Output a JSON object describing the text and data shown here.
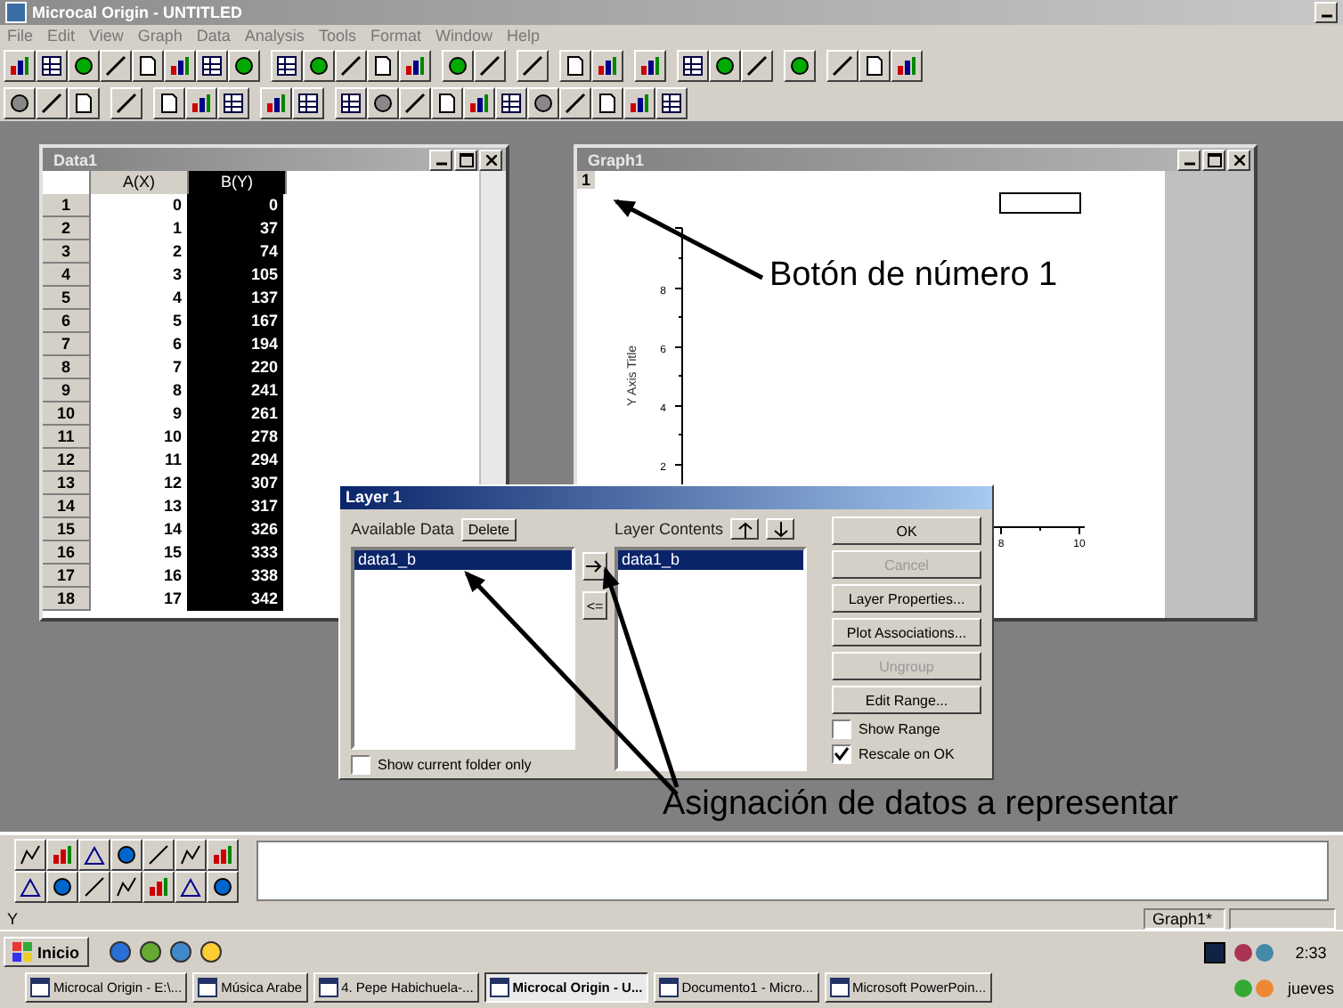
{
  "window": {
    "title": "Microcal Origin - UNTITLED"
  },
  "menu": [
    "File",
    "Edit",
    "View",
    "Graph",
    "Data",
    "Analysis",
    "Tools",
    "Format",
    "Window",
    "Help"
  ],
  "worksheet": {
    "title": "Data1",
    "columns": [
      {
        "label": "A(X)",
        "selected": false
      },
      {
        "label": "B(Y)",
        "selected": true
      }
    ],
    "rows": [
      {
        "index": "1",
        "values": [
          "0",
          "0"
        ]
      },
      {
        "index": "2",
        "values": [
          "1",
          "37"
        ]
      },
      {
        "index": "3",
        "values": [
          "2",
          "74"
        ]
      },
      {
        "index": "4",
        "values": [
          "3",
          "105"
        ]
      },
      {
        "index": "5",
        "values": [
          "4",
          "137"
        ]
      },
      {
        "index": "6",
        "values": [
          "5",
          "167"
        ]
      },
      {
        "index": "7",
        "values": [
          "6",
          "194"
        ]
      },
      {
        "index": "8",
        "values": [
          "7",
          "220"
        ]
      },
      {
        "index": "9",
        "values": [
          "8",
          "241"
        ]
      },
      {
        "index": "10",
        "values": [
          "9",
          "261"
        ]
      },
      {
        "index": "11",
        "values": [
          "10",
          "278"
        ]
      },
      {
        "index": "12",
        "values": [
          "11",
          "294"
        ]
      },
      {
        "index": "13",
        "values": [
          "12",
          "307"
        ]
      },
      {
        "index": "14",
        "values": [
          "13",
          "317"
        ]
      },
      {
        "index": "15",
        "values": [
          "14",
          "326"
        ]
      },
      {
        "index": "16",
        "values": [
          "15",
          "333"
        ]
      },
      {
        "index": "17",
        "values": [
          "16",
          "338"
        ]
      },
      {
        "index": "18",
        "values": [
          "17",
          "342"
        ]
      }
    ]
  },
  "graph": {
    "title": "Graph1",
    "layer_button": "1",
    "y_axis_title": "Y Axis Title",
    "y_ticks": [
      "8",
      "6",
      "4",
      "2"
    ],
    "x_ticks": [
      "8",
      "10"
    ]
  },
  "annotations": [
    {
      "text": "Botón de número 1"
    },
    {
      "text": "Asignación de datos a representar"
    }
  ],
  "dialog": {
    "title": "Layer 1",
    "available_label": "Available Data",
    "delete_button": "Delete",
    "available": [
      {
        "label": "data1_b",
        "selected": true
      }
    ],
    "remove_button": "<=",
    "contents_label": "Layer Contents",
    "contents": [
      {
        "label": "data1_b",
        "selected": true
      }
    ],
    "buttons": [
      {
        "label": "OK",
        "disabled": false
      },
      {
        "label": "Cancel",
        "disabled": true
      },
      {
        "label": "Layer Properties...",
        "disabled": false
      },
      {
        "label": "Plot Associations...",
        "disabled": false
      },
      {
        "label": "Ungroup",
        "disabled": true
      },
      {
        "label": "Edit Range...",
        "disabled": false
      }
    ],
    "checks": [
      {
        "label": "Show Range",
        "checked": false
      },
      {
        "label": "Rescale on OK",
        "checked": true
      }
    ],
    "folder_check": {
      "label": "Show current folder only",
      "checked": false
    }
  },
  "status_bar": {
    "text": "Y",
    "window": "Graph1*"
  },
  "taskbar": {
    "start": "Inicio",
    "tasks": [
      {
        "label": "Microcal Origin - E:\\...",
        "selected": false
      },
      {
        "label": "Música Arabe",
        "selected": false
      },
      {
        "label": "4. Pepe Habichuela-...",
        "selected": false
      },
      {
        "label": "Microcal Origin - U...",
        "selected": true
      },
      {
        "label": "Documento1 - Micro...",
        "selected": false
      },
      {
        "label": "Microsoft PowerPoin...",
        "selected": false
      }
    ],
    "time": "2:33",
    "day": "jueves"
  }
}
